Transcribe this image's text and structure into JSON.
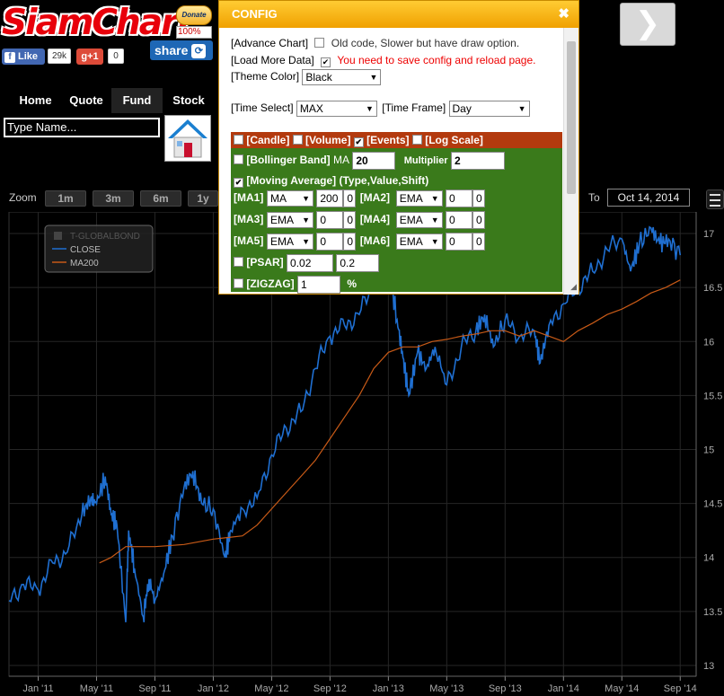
{
  "header": {
    "logo": "SiamChart",
    "donate": "Donate",
    "donate_pct": "100%",
    "share": "share",
    "fb_like": "Like",
    "fb_count": "29k",
    "gplus": "g+1",
    "gplus_count": "0"
  },
  "nav": {
    "items": [
      "Home",
      "Quote",
      "Fund",
      "Stock"
    ],
    "active": "Fund"
  },
  "search": {
    "placeholder": "Type Name..."
  },
  "zoom": {
    "label": "Zoom",
    "buttons": [
      "1m",
      "3m",
      "6m",
      "1y"
    ]
  },
  "range": {
    "to_label": "To",
    "to_value": "Oct 14, 2014"
  },
  "config": {
    "title": "CONFIG",
    "advance_chart": {
      "label": "[Advance Chart]",
      "checked": false,
      "note": "Old code, Slower but have draw option."
    },
    "load_more": {
      "label": "[Load More Data]",
      "checked": true,
      "note": "You need to save config and reload page."
    },
    "theme": {
      "label": "[Theme Color]",
      "value": "Black"
    },
    "time_select": {
      "label": "[Time Select]",
      "value": "MAX"
    },
    "time_frame": {
      "label": "[Time Frame]",
      "value": "Day"
    },
    "candle": "[Candle]",
    "volume": "[Volume]",
    "events": "[Events]",
    "log_scale": "[Log Scale]",
    "bollinger": {
      "label": "[Bollinger Band]",
      "ma_label": "MA",
      "ma": "20",
      "mult_label": "Multiplier",
      "mult": "2"
    },
    "moving_average": {
      "label": "[Moving Average] (Type,Value,Shift)",
      "checked": true
    },
    "ma": [
      {
        "label": "[MA1]",
        "type": "MA",
        "value": "200",
        "shift": "0"
      },
      {
        "label": "[MA2]",
        "type": "EMA",
        "value": "0",
        "shift": "0"
      },
      {
        "label": "[MA3]",
        "type": "EMA",
        "value": "0",
        "shift": "0"
      },
      {
        "label": "[MA4]",
        "type": "EMA",
        "value": "0",
        "shift": "0"
      },
      {
        "label": "[MA5]",
        "type": "EMA",
        "value": "0",
        "shift": "0"
      },
      {
        "label": "[MA6]",
        "type": "EMA",
        "value": "0",
        "shift": "0"
      }
    ],
    "psar": {
      "label": "[PSAR]",
      "v1": "0.02",
      "v2": "0.2"
    },
    "zigzag": {
      "label": "[ZIGZAG]",
      "value": "1",
      "unit": "%"
    }
  },
  "colors": {
    "close": "#1f6fd1",
    "ma200": "#c85a17",
    "config_header": "#f5a800",
    "events_bar": "#b33a0e",
    "indicator_panel": "#3a7a1b"
  },
  "chart_data": {
    "type": "line",
    "legend": [
      "T-GLOBALBOND",
      "CLOSE",
      "MA200"
    ],
    "legend_position": "top-left",
    "x_ticks": [
      "Jan '11",
      "May '11",
      "Sep '11",
      "Jan '12",
      "May '12",
      "Sep '12",
      "Jan '13",
      "May '13",
      "Sep '13",
      "Jan '14",
      "May '14",
      "Sep '14"
    ],
    "y_ticks": [
      "13",
      "13.5",
      "14",
      "14.5",
      "15",
      "15.5",
      "16",
      "16.5",
      "17"
    ],
    "ylim": [
      12.9,
      17.2
    ],
    "grid": true,
    "series": [
      {
        "name": "CLOSE",
        "points": [
          [
            0,
            13.6
          ],
          [
            0.5,
            13.75
          ],
          [
            1,
            13.7
          ],
          [
            1.5,
            13.95
          ],
          [
            2,
            14.05
          ],
          [
            2.5,
            14.4
          ],
          [
            2.8,
            14.55
          ],
          [
            3,
            14.5
          ],
          [
            3.3,
            14.75
          ],
          [
            3.5,
            14.4
          ],
          [
            3.7,
            14.3
          ],
          [
            4,
            13.4
          ],
          [
            4.1,
            14.25
          ],
          [
            4.3,
            13.9
          ],
          [
            4.6,
            13.45
          ],
          [
            4.8,
            13.8
          ],
          [
            5,
            13.6
          ],
          [
            5.3,
            13.85
          ],
          [
            5.6,
            14.2
          ],
          [
            6,
            14.65
          ],
          [
            6.3,
            14.8
          ],
          [
            6.6,
            14.5
          ],
          [
            7,
            14.45
          ],
          [
            7.4,
            14.0
          ],
          [
            7.6,
            14.25
          ],
          [
            8,
            14.45
          ],
          [
            8.5,
            14.55
          ],
          [
            9,
            14.95
          ],
          [
            9.5,
            15.2
          ],
          [
            10,
            15.35
          ],
          [
            10.5,
            15.75
          ],
          [
            11,
            16.05
          ],
          [
            11.5,
            16.15
          ],
          [
            12,
            16.25
          ],
          [
            12.5,
            16.55
          ],
          [
            13,
            16.7
          ],
          [
            13.3,
            16.2
          ],
          [
            13.5,
            15.85
          ],
          [
            13.7,
            15.5
          ],
          [
            14,
            15.9
          ],
          [
            14.3,
            15.75
          ],
          [
            14.6,
            15.95
          ],
          [
            15,
            15.6
          ],
          [
            15.5,
            15.95
          ],
          [
            16,
            16.1
          ],
          [
            16.3,
            16.25
          ],
          [
            16.6,
            15.95
          ],
          [
            17,
            16.2
          ],
          [
            17.5,
            16.05
          ],
          [
            18,
            16.1
          ],
          [
            18.2,
            15.8
          ],
          [
            18.5,
            16.15
          ],
          [
            19,
            16.35
          ],
          [
            19.5,
            16.5
          ],
          [
            20,
            16.65
          ],
          [
            20.5,
            16.85
          ],
          [
            21,
            16.95
          ],
          [
            21.3,
            16.65
          ],
          [
            21.6,
            16.9
          ],
          [
            22,
            17.05
          ],
          [
            22.3,
            16.9
          ],
          [
            22.6,
            16.95
          ],
          [
            23,
            16.8
          ]
        ]
      },
      {
        "name": "MA200",
        "points": [
          [
            3.1,
            13.95
          ],
          [
            3.5,
            14.0
          ],
          [
            4,
            14.1
          ],
          [
            5,
            14.1
          ],
          [
            6,
            14.12
          ],
          [
            7,
            14.17
          ],
          [
            8,
            14.2
          ],
          [
            8.5,
            14.3
          ],
          [
            9,
            14.45
          ],
          [
            9.5,
            14.6
          ],
          [
            10,
            14.75
          ],
          [
            10.5,
            14.9
          ],
          [
            11,
            15.1
          ],
          [
            11.5,
            15.3
          ],
          [
            12,
            15.5
          ],
          [
            12.5,
            15.75
          ],
          [
            13,
            15.9
          ],
          [
            13.5,
            15.95
          ],
          [
            14,
            15.95
          ],
          [
            14.5,
            16.0
          ],
          [
            15,
            16.02
          ],
          [
            15.5,
            16.05
          ],
          [
            16,
            16.07
          ],
          [
            16.5,
            16.1
          ],
          [
            17,
            16.1
          ],
          [
            17.5,
            16.05
          ],
          [
            18,
            16.1
          ],
          [
            18.5,
            16.05
          ],
          [
            19,
            16.0
          ],
          [
            19.5,
            16.1
          ],
          [
            20,
            16.17
          ],
          [
            20.5,
            16.25
          ],
          [
            21,
            16.3
          ],
          [
            21.5,
            16.37
          ],
          [
            22,
            16.45
          ],
          [
            22.5,
            16.5
          ],
          [
            23,
            16.57
          ]
        ]
      }
    ]
  }
}
